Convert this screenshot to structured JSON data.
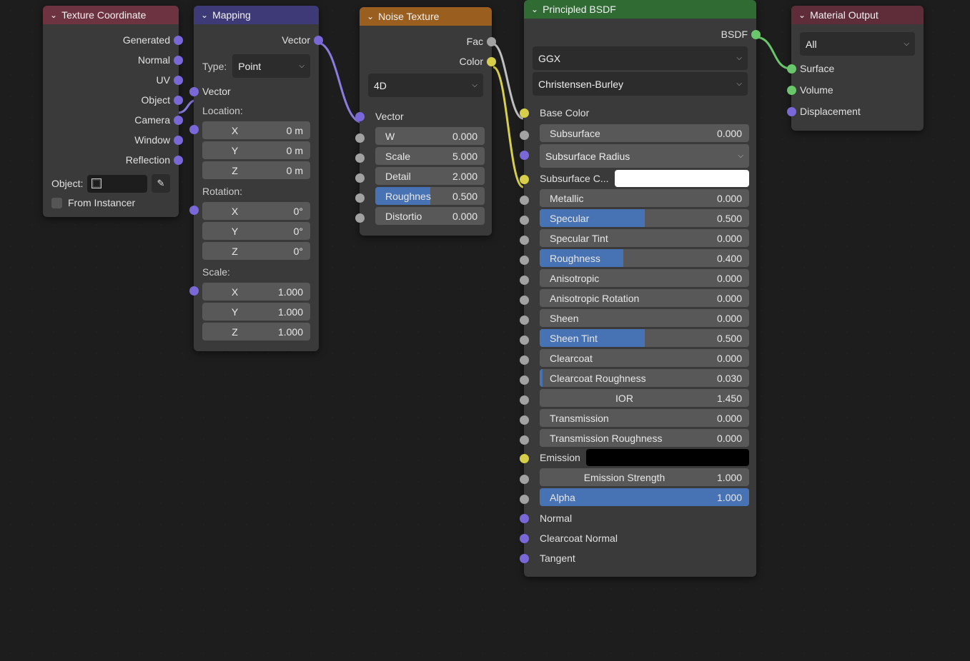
{
  "texcoord": {
    "title": "Texture Coordinate",
    "outputs": [
      "Generated",
      "Normal",
      "UV",
      "Object",
      "Camera",
      "Window",
      "Reflection"
    ],
    "object_label": "Object:",
    "from_instancer": "From Instancer"
  },
  "mapping": {
    "title": "Mapping",
    "out_vector": "Vector",
    "type_label": "Type:",
    "type_value": "Point",
    "in_vector": "Vector",
    "loc_label": "Location:",
    "loc": {
      "x": "X",
      "xv": "0 m",
      "y": "Y",
      "yv": "0 m",
      "z": "Z",
      "zv": "0 m"
    },
    "rot_label": "Rotation:",
    "rot": {
      "x": "X",
      "xv": "0°",
      "y": "Y",
      "yv": "0°",
      "z": "Z",
      "zv": "0°"
    },
    "scale_label": "Scale:",
    "scale": {
      "x": "X",
      "xv": "1.000",
      "y": "Y",
      "yv": "1.000",
      "z": "Z",
      "zv": "1.000"
    }
  },
  "noise": {
    "title": "Noise Texture",
    "out_fac": "Fac",
    "out_color": "Color",
    "dim": "4D",
    "in_vector": "Vector",
    "w": {
      "l": "W",
      "v": "0.000"
    },
    "scale": {
      "l": "Scale",
      "v": "5.000"
    },
    "detail": {
      "l": "Detail",
      "v": "2.000"
    },
    "rough": {
      "l": "Roughnes",
      "v": "0.500"
    },
    "dist": {
      "l": "Distortio",
      "v": "0.000"
    }
  },
  "bsdf": {
    "title": "Principled BSDF",
    "out": "BSDF",
    "dist": "GGX",
    "sss_method": "Christensen-Burley",
    "base_color": "Base Color",
    "subsurface": {
      "l": "Subsurface",
      "v": "0.000"
    },
    "sss_radius": "Subsurface Radius",
    "sss_color": "Subsurface C...",
    "metallic": {
      "l": "Metallic",
      "v": "0.000"
    },
    "specular": {
      "l": "Specular",
      "v": "0.500"
    },
    "spectint": {
      "l": "Specular Tint",
      "v": "0.000"
    },
    "roughness": {
      "l": "Roughness",
      "v": "0.400"
    },
    "aniso": {
      "l": "Anisotropic",
      "v": "0.000"
    },
    "anisorot": {
      "l": "Anisotropic Rotation",
      "v": "0.000"
    },
    "sheen": {
      "l": "Sheen",
      "v": "0.000"
    },
    "sheentint": {
      "l": "Sheen Tint",
      "v": "0.500"
    },
    "clearcoat": {
      "l": "Clearcoat",
      "v": "0.000"
    },
    "ccrough": {
      "l": "Clearcoat Roughness",
      "v": "0.030"
    },
    "ior": {
      "l": "IOR",
      "v": "1.450"
    },
    "trans": {
      "l": "Transmission",
      "v": "0.000"
    },
    "transrough": {
      "l": "Transmission Roughness",
      "v": "0.000"
    },
    "emission": "Emission",
    "emitstr": {
      "l": "Emission Strength",
      "v": "1.000"
    },
    "alpha": {
      "l": "Alpha",
      "v": "1.000"
    },
    "normal": "Normal",
    "ccnormal": "Clearcoat Normal",
    "tangent": "Tangent"
  },
  "output": {
    "title": "Material Output",
    "target": "All",
    "surface": "Surface",
    "volume": "Volume",
    "disp": "Displacement"
  }
}
